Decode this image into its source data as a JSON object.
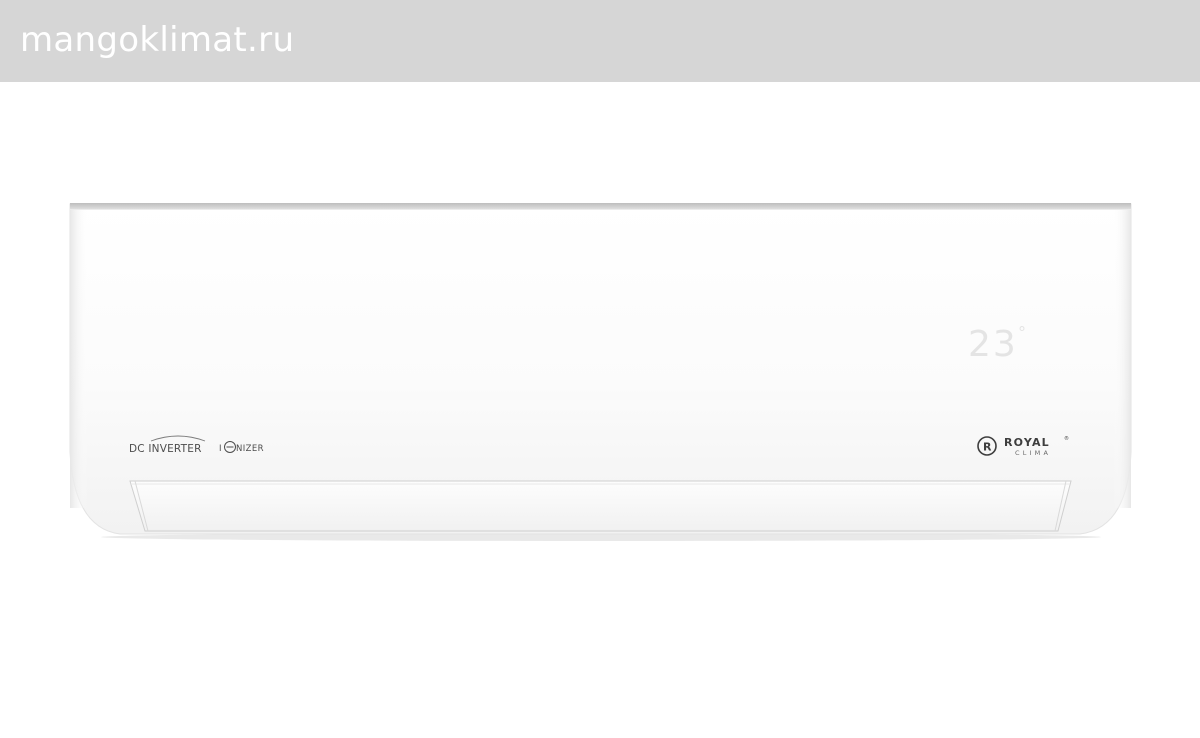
{
  "header": {
    "site_name": "mangoklimat.ru",
    "background_color": "#d6d6d6",
    "text_color": "#ffffff"
  },
  "product": {
    "type": "wall-mounted air conditioner indoor unit",
    "body_color": "#ffffff",
    "display": {
      "temperature": "23",
      "degree_symbol": "°"
    },
    "badges": {
      "dc_inverter": "DC INVERTER",
      "ionizer_prefix": "I",
      "ionizer_rest": "NIZER"
    },
    "brand": {
      "logo_letter": "R",
      "name": "ROYAL",
      "registered_mark": "®",
      "sub": "CLIMA"
    }
  }
}
